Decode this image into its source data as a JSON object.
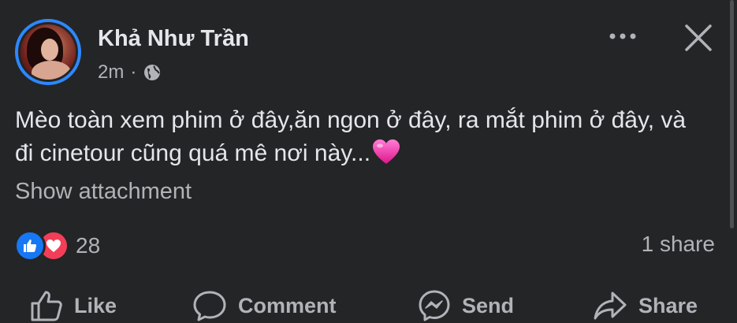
{
  "post": {
    "author": "Khả Như Trần",
    "time": "2m",
    "separator": "·",
    "privacy_icon": "globe-icon",
    "text": "Mèo toàn xem phim ở đây,ăn ngon ở đây, ra mắt phim ở đây, và đi cinetour cũng  quá mê nơi này...",
    "text_emoji": "pink-heart-emoji",
    "attachment_label": "Show attachment"
  },
  "reactions": {
    "count": "28",
    "types": [
      "like-reaction-icon",
      "love-reaction-icon"
    ],
    "shares": "1 share"
  },
  "actions": {
    "like": "Like",
    "comment": "Comment",
    "send": "Send",
    "share": "Share"
  },
  "colors": {
    "background": "#242526",
    "text_primary": "#e4e6eb",
    "text_secondary": "#b0b3b8",
    "accent_blue": "#1877f2",
    "love_red": "#f33e58"
  }
}
